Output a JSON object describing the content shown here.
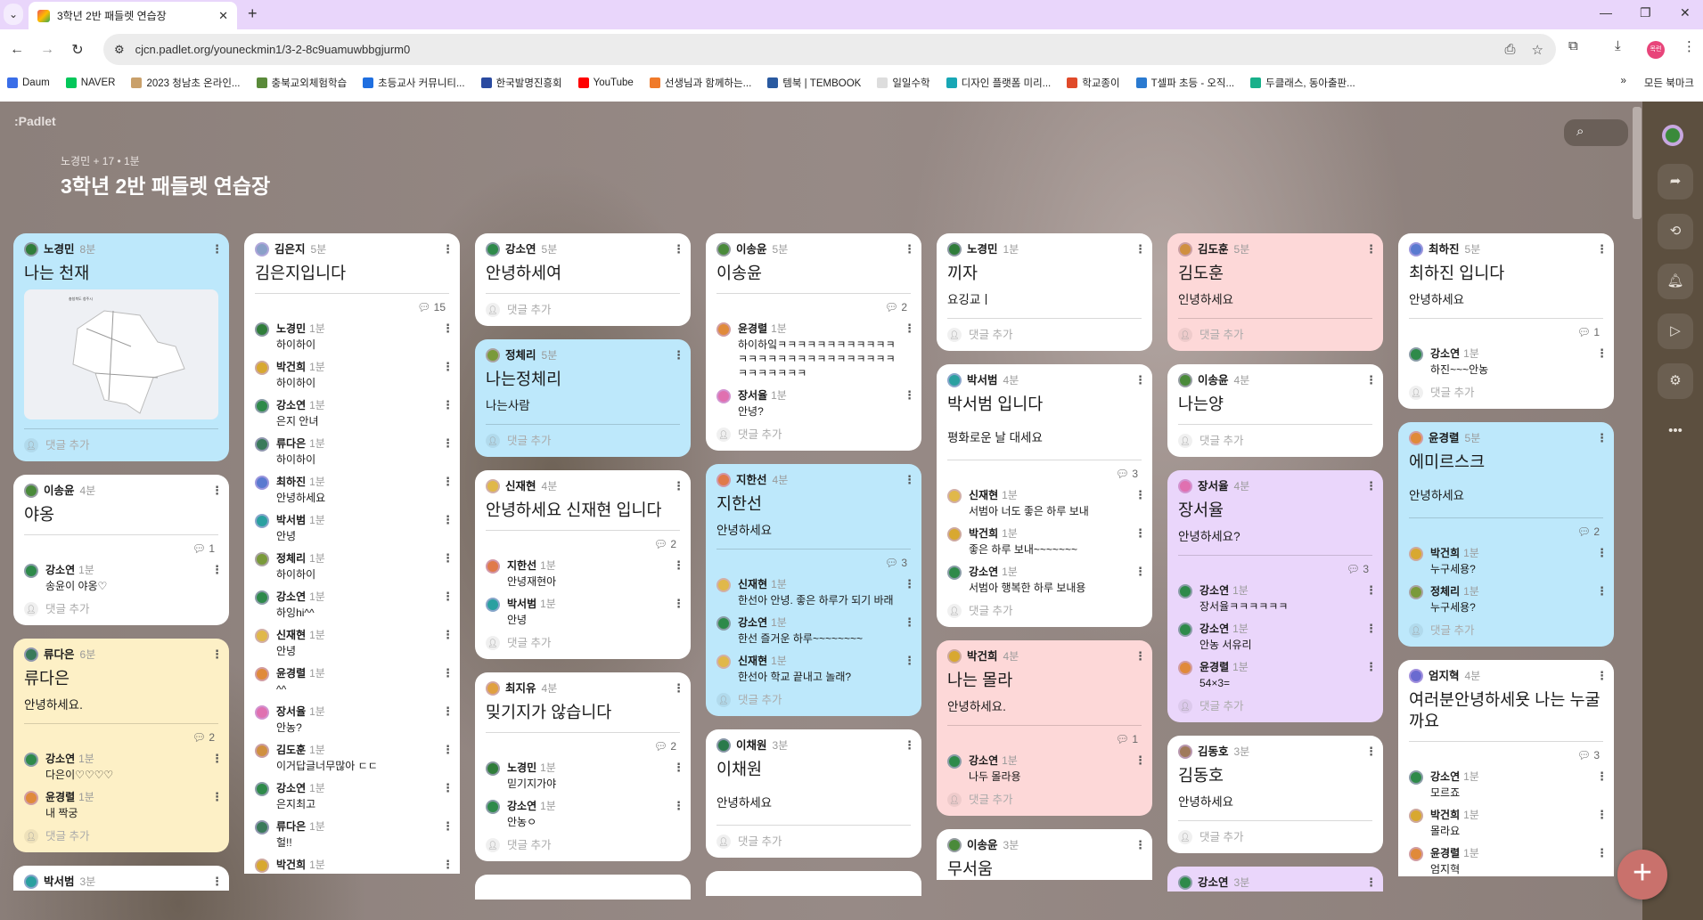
{
  "browser": {
    "tab_title": "3학년 2반 패들렛 연습장",
    "url": "cjcn.padlet.org/youneckmin1/3-2-8c9uamuwbbgjurm0",
    "profile_label": "목련",
    "bookmarks": [
      {
        "label": "Daum",
        "color": "#3a6ee8"
      },
      {
        "label": "NAVER",
        "color": "#03c75a"
      },
      {
        "label": "2023 청남초 온라인...",
        "color": "#c9a06a"
      },
      {
        "label": "충북교외체험학습",
        "color": "#5a8a3a"
      },
      {
        "label": "초등교사 커뮤니티...",
        "color": "#1f6fe0"
      },
      {
        "label": "한국발명진흥회",
        "color": "#2a4aa0"
      },
      {
        "label": "YouTube",
        "color": "#ff0000"
      },
      {
        "label": "선생님과 함께하는...",
        "color": "#f07a2a"
      },
      {
        "label": "템북 | TEMBOOK",
        "color": "#2a5aa0"
      },
      {
        "label": "일일수학",
        "color": "#dddddd"
      },
      {
        "label": "디자인 플랫폼 미리...",
        "color": "#18a7b5"
      },
      {
        "label": "학교종이",
        "color": "#e04a2a"
      },
      {
        "label": "T셀파 초등 - 오직...",
        "color": "#2a7ad0"
      },
      {
        "label": "두클래스, 동아출판...",
        "color": "#18b08a"
      }
    ],
    "all_bookmarks": "모든 북마크"
  },
  "board": {
    "logo": ":Padlet",
    "meta": "노경민 + 17 • 1분",
    "title": "3학년 2반 패들렛 연습장",
    "add_comment": "댓글 추가",
    "fab": "+"
  },
  "colors": {
    "white": "#ffffff",
    "blue": "#bde8fb",
    "yellow": "#fdf0c6",
    "pink": "#fdd8d8",
    "purple": "#ead6fb",
    "rail": "#5c4f3f",
    "fab": "#c9716c"
  },
  "avatar_colors": {
    "노경민": "#2f7d3a",
    "김은지": "#8aa0c8",
    "강소연": "#2e8a4a",
    "이송윤": "#4a8a3a",
    "정체리": "#7a9a3a",
    "신재현": "#e0b84a",
    "류다은": "#3a7a5a",
    "박건희": "#d8a830",
    "지한선": "#e07a4a",
    "최지유": "#e0a040",
    "윤경렬": "#e08a3a",
    "장서율": "#e070b0",
    "박서범": "#2aa0a0",
    "최하진": "#5a7ad0",
    "김도훈": "#d09040",
    "이채원": "#2a7a4a",
    "김동호": "#a07a5a",
    "엄지혁": "#6a6ad0"
  },
  "columns": [
    {
      "cards": [
        {
          "author": "노경민",
          "time": "8분",
          "title": "나는 천재",
          "color": "blue",
          "image": "map-image"
        },
        {
          "author": "이송윤",
          "time": "4분",
          "title": "야옹",
          "color": "white",
          "comment_count": "1",
          "comments": [
            {
              "author": "강소연",
              "time": "1분",
              "text": "송윤이 야옹♡"
            }
          ]
        },
        {
          "author": "류다은",
          "time": "6분",
          "title": "류다은",
          "body": "안녕하세요.",
          "color": "yellow",
          "comment_count": "2",
          "comments": [
            {
              "author": "강소연",
              "time": "1분",
              "text": "다은이♡♡♡♡"
            },
            {
              "author": "윤경렬",
              "time": "1분",
              "text": "내 짝궁"
            }
          ]
        },
        {
          "author": "박서범",
          "time": "3분",
          "color": "white",
          "cut": true
        }
      ]
    },
    {
      "cards": [
        {
          "author": "김은지",
          "time": "5분",
          "title": "김은지입니다",
          "color": "white",
          "comment_count": "15",
          "comments": [
            {
              "author": "노경민",
              "time": "1분",
              "text": "하이하이"
            },
            {
              "author": "박건희",
              "time": "1분",
              "text": "하이하이"
            },
            {
              "author": "강소연",
              "time": "1분",
              "text": "은지 안녀"
            },
            {
              "author": "류다은",
              "time": "1분",
              "text": "하이하이"
            },
            {
              "author": "최하진",
              "time": "1분",
              "text": "안녕하세요"
            },
            {
              "author": "박서범",
              "time": "1분",
              "text": "안녕"
            },
            {
              "author": "정체리",
              "time": "1분",
              "text": "하이하이"
            },
            {
              "author": "강소연",
              "time": "1분",
              "text": "하잉hi^^"
            },
            {
              "author": "신재현",
              "time": "1분",
              "text": "안녕"
            },
            {
              "author": "윤경렬",
              "time": "1분",
              "text": "^^"
            },
            {
              "author": "장서율",
              "time": "1분",
              "text": "안농?"
            },
            {
              "author": "김도훈",
              "time": "1분",
              "text": "이거답글너무많아 ㄷㄷ"
            },
            {
              "author": "강소연",
              "time": "1분",
              "text": "은지최고"
            },
            {
              "author": "류다은",
              "time": "1분",
              "text": "헐!!"
            },
            {
              "author": "박건희",
              "time": "1분",
              "text": ""
            }
          ],
          "cut": true
        }
      ]
    },
    {
      "cards": [
        {
          "author": "강소연",
          "time": "5분",
          "title": "안녕하세여",
          "color": "white"
        },
        {
          "author": "정체리",
          "time": "5분",
          "title": "나는정체리",
          "body": "나는사람",
          "color": "blue"
        },
        {
          "author": "신재현",
          "time": "4분",
          "title": "안녕하세요 신재현 입니다",
          "color": "white",
          "comment_count": "2",
          "comments": [
            {
              "author": "지한선",
              "time": "1분",
              "text": "안녕재현아"
            },
            {
              "author": "박서범",
              "time": "1분",
              "text": "안녕"
            }
          ]
        },
        {
          "author": "최지유",
          "time": "4분",
          "title": "밎기지가 않습니다",
          "color": "white",
          "comment_count": "2",
          "comments": [
            {
              "author": "노경민",
              "time": "1분",
              "text": "믿기지가야"
            },
            {
              "author": "강소연",
              "time": "1분",
              "text": "안농ㅇ"
            }
          ]
        },
        {
          "color": "white",
          "cut": true
        }
      ]
    },
    {
      "cards": [
        {
          "author": "이송윤",
          "time": "5분",
          "title": "이송윤",
          "color": "white",
          "comment_count": "2",
          "comments": [
            {
              "author": "윤경렬",
              "time": "1분",
              "text": "하이하잌ㅋㅋㅋㅋㅋㅋㅋㅋㅋㅋㅋㅋㅋㅋㅋㅋㅋㅋㅋㅋㅋㅋㅋㅋㅋㅋㅋㅋㅋㅋㅋㅋㅋㅋㅋ"
            },
            {
              "author": "장서율",
              "time": "1분",
              "text": "안녕?"
            }
          ]
        },
        {
          "author": "지한선",
          "time": "4분",
          "title": "지한선",
          "body": "안녕하세요",
          "color": "blue",
          "comment_count": "3",
          "comments": [
            {
              "author": "신재현",
              "time": "1분",
              "text": "한선아 안녕. 좋은 하루가 되기 바래"
            },
            {
              "author": "강소연",
              "time": "1분",
              "text": "한선 즐거운 하루~~~~~~~~"
            },
            {
              "author": "신재현",
              "time": "1분",
              "text": "한선아 학교 끝내고 놀래?"
            }
          ]
        },
        {
          "author": "이채원",
          "time": "3분",
          "title": "이채원",
          "body": "안녕하세요",
          "color": "white",
          "tall_body": true
        },
        {
          "color": "white",
          "cut": true
        }
      ]
    },
    {
      "cards": [
        {
          "author": "노경민",
          "time": "1분",
          "title": "끼자",
          "body": "요깅교ㅣ",
          "color": "white"
        },
        {
          "author": "박서범",
          "time": "4분",
          "title": "박서범 입니다",
          "body": "평화로운 날 대세요",
          "color": "white",
          "tall_body": true,
          "comment_count": "3",
          "comments": [
            {
              "author": "신재현",
              "time": "1분",
              "text": "서범아 너도 좋은 하루 보내"
            },
            {
              "author": "박건희",
              "time": "1분",
              "text": "좋은 하루 보내~~~~~~~"
            },
            {
              "author": "강소연",
              "time": "1분",
              "text": "서범아 행복한 하루 보내용"
            }
          ]
        },
        {
          "author": "박건희",
          "time": "4분",
          "title": "나는 몰라",
          "body": "안녕하세요.",
          "color": "pink",
          "comment_count": "1",
          "comments": [
            {
              "author": "강소연",
              "time": "1분",
              "text": "나두 몰라용"
            }
          ]
        },
        {
          "author": "이송윤",
          "time": "3분",
          "title": "무서움",
          "color": "white",
          "cut": true
        }
      ]
    },
    {
      "cards": [
        {
          "author": "김도훈",
          "time": "5분",
          "title": "김도훈",
          "body": "인녕하세요",
          "color": "pink"
        },
        {
          "author": "이송윤",
          "time": "4분",
          "title": "나는양",
          "color": "white"
        },
        {
          "author": "장서율",
          "time": "4분",
          "title": "장서율",
          "body": "안녕하세요?",
          "color": "purple",
          "comment_count": "3",
          "comments": [
            {
              "author": "강소연",
              "time": "1분",
              "text": "장서율ㅋㅋㅋㅋㅋㅋ"
            },
            {
              "author": "강소연",
              "time": "1분",
              "text": "안농 서유리"
            },
            {
              "author": "윤경렬",
              "time": "1분",
              "text": "54×3="
            }
          ]
        },
        {
          "author": "김동호",
          "time": "3분",
          "title": "김동호",
          "body": "안녕하세요",
          "color": "white"
        },
        {
          "author": "강소연",
          "time": "3분",
          "color": "purple",
          "cut": true
        }
      ]
    },
    {
      "cards": [
        {
          "author": "최하진",
          "time": "5분",
          "title": "최하진 입니다",
          "body": "안녕하세요",
          "color": "white",
          "comment_count": "1",
          "comments": [
            {
              "author": "강소연",
              "time": "1분",
              "text": "하진~~~안농"
            }
          ]
        },
        {
          "author": "윤경렬",
          "time": "5분",
          "title": "에미르스크",
          "body": "안녕하세요",
          "color": "blue",
          "tall_body": true,
          "comment_count": "2",
          "comments": [
            {
              "author": "박건희",
              "time": "1분",
              "text": "누구세용?"
            },
            {
              "author": "정체리",
              "time": "1분",
              "text": "누구세용?"
            }
          ]
        },
        {
          "author": "엄지혁",
          "time": "4분",
          "title": "여러분안녕하세욧 나는 누굴까요",
          "color": "white",
          "comment_count": "3",
          "comments": [
            {
              "author": "강소연",
              "time": "1분",
              "text": "모르죠"
            },
            {
              "author": "박건희",
              "time": "1분",
              "text": "몰라요"
            },
            {
              "author": "윤경렬",
              "time": "1분",
              "text": "엄지혁"
            }
          ],
          "cut": true
        }
      ]
    }
  ]
}
